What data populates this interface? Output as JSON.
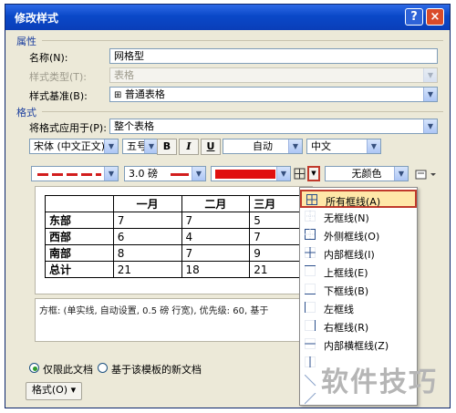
{
  "window": {
    "title": "修改样式",
    "help_label": "?",
    "close_label": "×"
  },
  "properties": {
    "section_label": "属性",
    "name_label": "名称(N):",
    "name_value": "网格型",
    "type_label": "样式类型(T):",
    "type_value": "表格",
    "base_label": "样式基准(B):",
    "base_value": "普通表格"
  },
  "format": {
    "section_label": "格式",
    "apply_label": "将格式应用于(P):",
    "apply_value": "整个表格",
    "font_value": "宋体 (中文正文)",
    "size_value": "五号",
    "bold_label": "B",
    "italic_label": "I",
    "underline_label": "U",
    "color_value": "自动",
    "lang_value": "中文",
    "line_weight_value": "3.0 磅",
    "shading_value": "无颜色"
  },
  "preview_table": {
    "headers": [
      "",
      "一月",
      "二月",
      "三月"
    ],
    "rows": [
      {
        "label": "东部",
        "values": [
          "7",
          "7",
          "5"
        ]
      },
      {
        "label": "西部",
        "values": [
          "6",
          "4",
          "7"
        ]
      },
      {
        "label": "南部",
        "values": [
          "8",
          "7",
          "9"
        ]
      },
      {
        "label": "总计",
        "values": [
          "21",
          "18",
          "21"
        ]
      }
    ]
  },
  "description": "方框: (单实线, 自动设置, 0.5 磅 行宽), 优先级: 60, 基于",
  "border_menu": {
    "items": [
      {
        "label": "所有框线(A)",
        "icon": "all-borders-icon",
        "selected": true
      },
      {
        "label": "无框线(N)",
        "icon": "no-border-icon"
      },
      {
        "label": "外侧框线(O)",
        "icon": "outside-borders-icon"
      },
      {
        "label": "内部框线(I)",
        "icon": "inside-borders-icon"
      },
      {
        "label": "上框线(E)",
        "icon": "top-border-icon"
      },
      {
        "label": "下框线(B)",
        "icon": "bottom-border-icon"
      },
      {
        "label": "左框线",
        "icon": "left-border-icon"
      },
      {
        "label": "右框线(R)",
        "icon": "right-border-icon"
      },
      {
        "label": "内部横框线(Z)",
        "icon": "inside-horizontal-border-icon"
      }
    ]
  },
  "options": {
    "this_doc_label": "仅限此文档",
    "template_label": "基于该模板的新文档",
    "this_doc_selected": true
  },
  "format_button": {
    "label": "格式(O) ▾"
  },
  "watermark": "软件技巧",
  "colors": {
    "title_blue": "#0a48c8",
    "border_red": "#e01010",
    "highlight": "#ffe7a8",
    "group_blue": "#1c3f9e"
  }
}
